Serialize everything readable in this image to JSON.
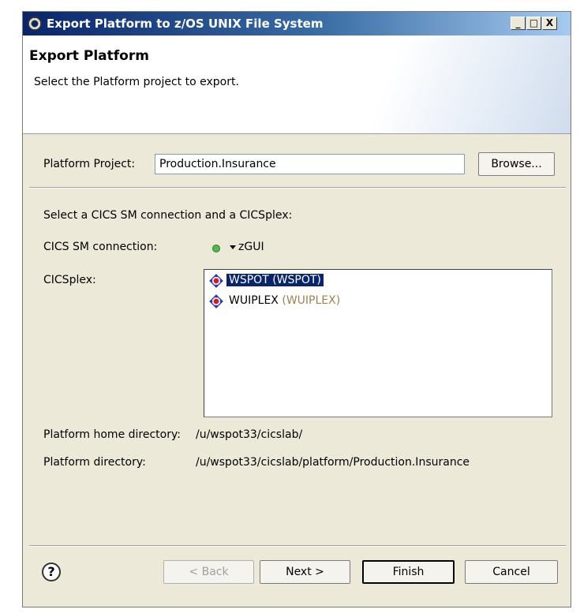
{
  "window": {
    "title": "Export Platform to z/OS UNIX File System",
    "minimize_glyph": "_",
    "maximize_glyph": "□",
    "close_glyph": "X"
  },
  "header": {
    "title": "Export Platform",
    "description": "Select the Platform project to export."
  },
  "project": {
    "label": "Platform Project:",
    "value": "Production.Insurance",
    "browse_label": "Browse..."
  },
  "connection": {
    "instruction": "Select a CICS SM connection and a CICSplex:",
    "label": "CICS SM connection:",
    "value": "zGUI",
    "status_color": "#52b652"
  },
  "cicsplex": {
    "label": "CICSplex:",
    "items": [
      {
        "name": "WSPOT (WSPOT)",
        "selected": true,
        "icon": "cicsplex-icon"
      },
      {
        "name": "WUIPLEX",
        "suffix": "(WUIPLEX)",
        "selected": false,
        "icon": "cicsplex-icon"
      }
    ]
  },
  "directories": {
    "home_label": "Platform home directory:",
    "home_value": "/u/wspot33/cicslab/",
    "platform_label": "Platform directory:",
    "platform_value": "/u/wspot33/cicslab/platform/Production.Insurance"
  },
  "buttons": {
    "help_glyph": "?",
    "back": "< Back",
    "next": "Next >",
    "finish": "Finish",
    "cancel": "Cancel"
  },
  "colors": {
    "selection": "#0a246a",
    "title_gradient_start": "#0a246a"
  }
}
